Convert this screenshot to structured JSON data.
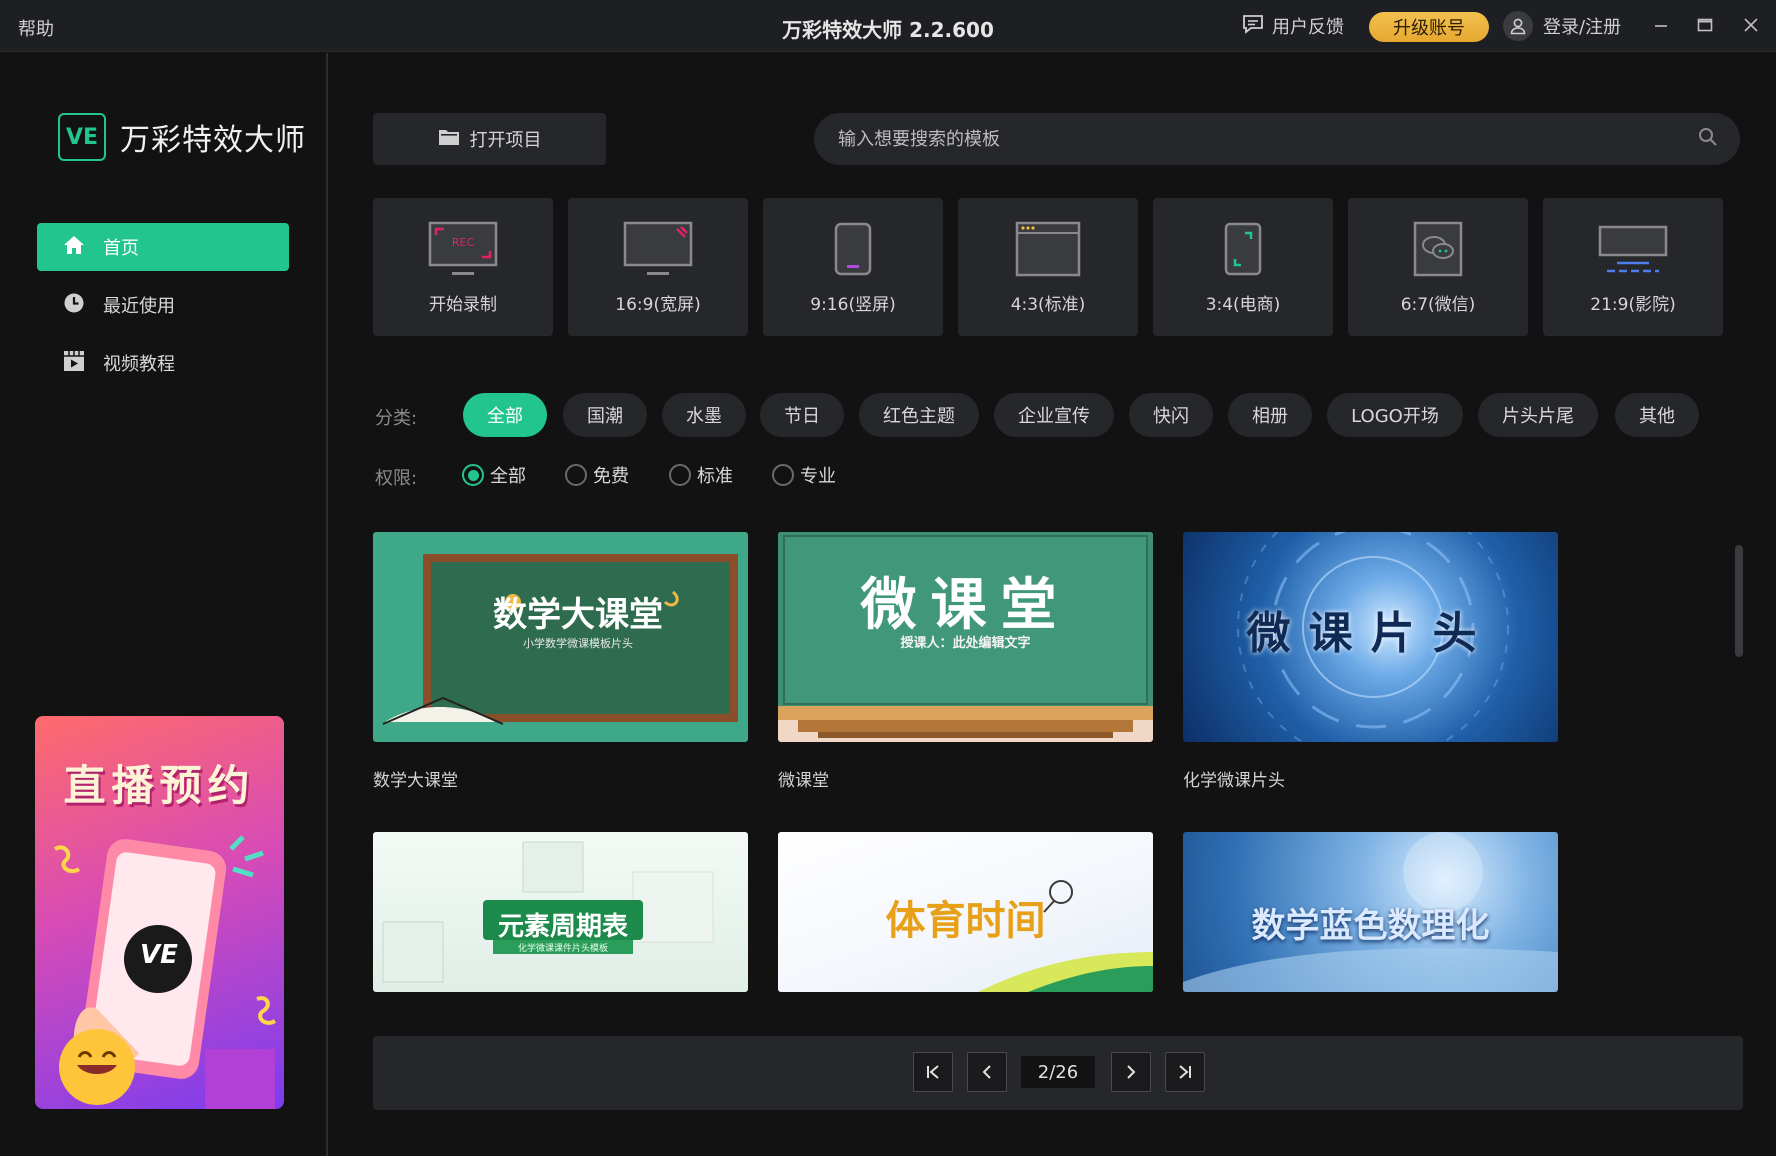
{
  "app": {
    "title": "万彩特效大师 2.2.600",
    "help_label": "帮助",
    "feedback_label": "用户反馈",
    "upgrade_label": "升级账号",
    "login_label": "登录/注册"
  },
  "sidebar": {
    "logo_mark": "VE",
    "logo_text": "万彩特效大师",
    "items": [
      {
        "label": "首页",
        "icon": "home-icon",
        "active": true
      },
      {
        "label": "最近使用",
        "icon": "clock-icon",
        "active": false
      },
      {
        "label": "视频教程",
        "icon": "video-tutorial-icon",
        "active": false
      }
    ],
    "promo": {
      "title": "直播预约",
      "badge": "VE"
    }
  },
  "toolbar": {
    "open_project_label": "打开项目",
    "search_placeholder": "输入想要搜索的模板"
  },
  "ratios": [
    {
      "label": "开始录制",
      "icon": "record-screen-icon",
      "rec_text": "REC"
    },
    {
      "label": "16:9(宽屏)",
      "icon": "widescreen-monitor-icon"
    },
    {
      "label": "9:16(竖屏)",
      "icon": "portrait-phone-icon"
    },
    {
      "label": "4:3(标准)",
      "icon": "standard-window-icon"
    },
    {
      "label": "3:4(电商)",
      "icon": "ecommerce-phone-icon"
    },
    {
      "label": "6:7(微信)",
      "icon": "wechat-icon"
    },
    {
      "label": "21:9(影院)",
      "icon": "cinema-screen-icon"
    }
  ],
  "filters": {
    "category_label": "分类:",
    "categories": [
      "全部",
      "国潮",
      "水墨",
      "节日",
      "红色主题",
      "企业宣传",
      "快闪",
      "相册",
      "LOGO开场",
      "片头片尾",
      "其他"
    ],
    "active_category": "全部",
    "permission_label": "权限:",
    "permissions": [
      "全部",
      "免费",
      "标准",
      "专业"
    ],
    "active_permission": "全部"
  },
  "templates": [
    {
      "name": "数学大课堂",
      "thumb_title": "数学大课堂",
      "thumb_sub": "小学数学微课模板片头"
    },
    {
      "name": "微课堂",
      "thumb_title": "微课堂",
      "thumb_sub": "授课人：此处编辑文字"
    },
    {
      "name": "化学微课片头",
      "thumb_title": "微课片头",
      "thumb_sub": ""
    },
    {
      "name": "",
      "thumb_title": "元素周期表",
      "thumb_sub": "化学微课课件片头模板"
    },
    {
      "name": "",
      "thumb_title": "体育时间",
      "thumb_sub": ""
    },
    {
      "name": "",
      "thumb_title": "数学蓝色数理化",
      "thumb_sub": ""
    }
  ],
  "pagination": {
    "current": 2,
    "total": 26,
    "display": "2/26"
  },
  "colors": {
    "accent": "#23c58e",
    "upgrade": "#f0b942",
    "panel": "#26272b",
    "background": "#121212"
  }
}
